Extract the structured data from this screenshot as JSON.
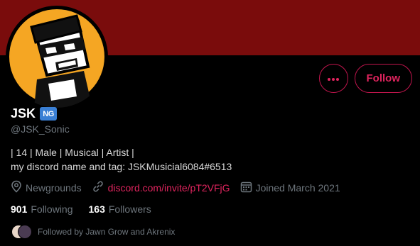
{
  "colors": {
    "banner": "#7a0c0c",
    "avatar_ring": "#f5a623",
    "accent": "#e0245e",
    "muted": "#6e767d",
    "ng_badge": "#3a7fd4"
  },
  "profile": {
    "display_name": "JSK",
    "badge_label": "NG",
    "handle": "@JSK_Sonic",
    "bio_line1": "| 14 | Male | Musical | Artist |",
    "bio_line2": "my discord name and tag: JSKMusicial6084#6513"
  },
  "actions": {
    "more_icon": "ellipsis-icon",
    "follow_label": "Follow"
  },
  "meta": {
    "location": "Newgrounds",
    "location_icon": "location-pin-icon",
    "link": "discord.com/invite/pT2VFjG",
    "link_icon": "link-icon",
    "joined": "Joined March 2021",
    "joined_icon": "calendar-icon"
  },
  "stats": {
    "following_count": "901",
    "following_label": "Following",
    "followers_count": "163",
    "followers_label": "Followers"
  },
  "followed_by": {
    "text": "Followed by Jawn Grow and Akrenix"
  }
}
